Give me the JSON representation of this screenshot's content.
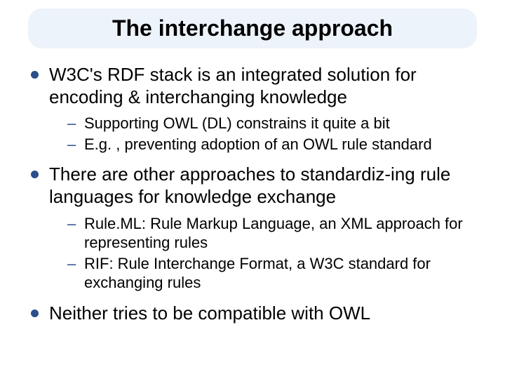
{
  "title": "The interchange approach",
  "bullets": [
    {
      "text": "W3C's RDF stack is an integrated solution for encoding & interchanging knowledge",
      "sub": [
        "Supporting  OWL (DL) constrains it quite a bit",
        "E.g. , preventing adoption of an OWL rule standard"
      ]
    },
    {
      "text": "There are other approaches to standardiz-ing rule languages for knowledge exchange",
      "sub": [
        "Rule.ML: Rule Markup Language, an XML approach for representing rules",
        "RIF: Rule Interchange Format, a W3C standard for exchanging rules"
      ]
    },
    {
      "text": "Neither tries to be compatible with OWL",
      "sub": []
    }
  ]
}
